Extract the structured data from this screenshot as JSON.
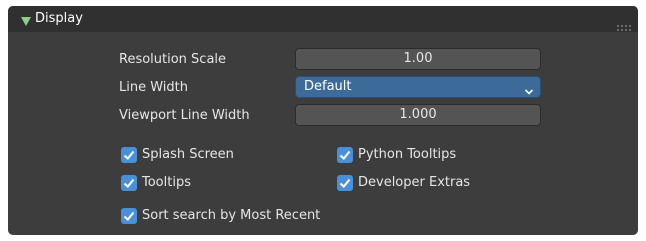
{
  "panel": {
    "title": "Display",
    "expanded": true
  },
  "settings": {
    "resolution_scale": {
      "label": "Resolution Scale",
      "value": "1.00"
    },
    "line_width": {
      "label": "Line Width",
      "value": "Default"
    },
    "viewport_line_width": {
      "label": "Viewport Line Width",
      "value": "1.000"
    }
  },
  "checkboxes": {
    "splash_screen": {
      "label": "Splash Screen",
      "checked": true
    },
    "python_tooltips": {
      "label": "Python Tooltips",
      "checked": true
    },
    "tooltips": {
      "label": "Tooltips",
      "checked": true
    },
    "developer_extras": {
      "label": "Developer Extras",
      "checked": true
    },
    "sort_search": {
      "label": "Sort search by Most Recent",
      "checked": true
    }
  },
  "icons": {
    "expand": "triangle-down-icon",
    "drag": "drag-handle-icon",
    "dropdown": "chevron-down-icon",
    "check": "checkmark-icon"
  },
  "colors": {
    "panel_bg": "#3d3d3d",
    "header_bg": "#303030",
    "field_bg": "#545454",
    "select_bg": "#3c6b9a",
    "checkbox_bg": "#4a90d9",
    "expand_arrow": "#7fc97f"
  }
}
